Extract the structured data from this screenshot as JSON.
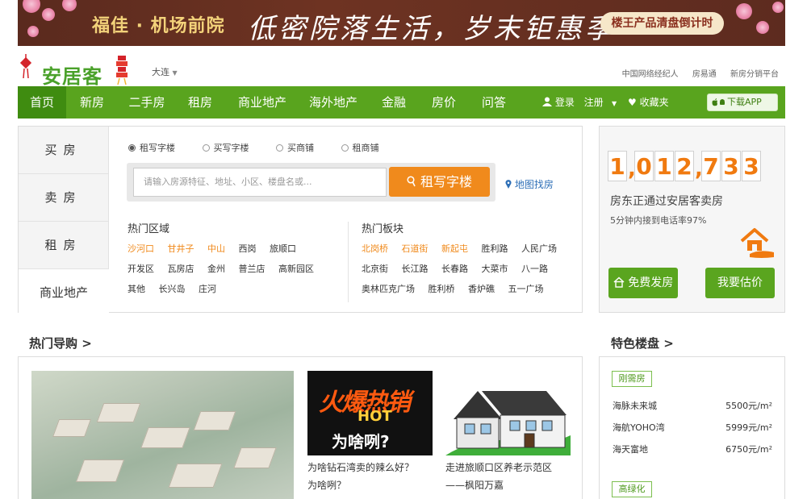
{
  "banner": {
    "brand": "福佳 · 机场前院",
    "slogan": "低密院落生活，岁末钜惠季",
    "cta": "楼王产品清盘倒计时"
  },
  "header": {
    "logo_text": "安居客",
    "city": "大连",
    "links": [
      "中国网络经纪人",
      "房易通",
      "新房分销平台"
    ]
  },
  "nav": {
    "items": [
      "首页",
      "新房",
      "二手房",
      "租房",
      "商业地产",
      "海外地产",
      "金融",
      "房价",
      "问答"
    ],
    "login": "登录",
    "register": "注册",
    "favorites": "收藏夹",
    "app": "下载APP"
  },
  "search": {
    "side_tabs": [
      "买房",
      "卖房",
      "租房",
      "商业地产"
    ],
    "radios": [
      "租写字楼",
      "买写字楼",
      "买商铺",
      "租商铺"
    ],
    "placeholder": "请输入房源特征、地址、小区、楼盘名或...",
    "button": "租写字楼",
    "map_link": "地图找房",
    "hot_areas": {
      "title": "热门区域",
      "rows": [
        [
          "沙河口",
          "甘井子",
          "中山",
          "西岗",
          "旅顺口"
        ],
        [
          "开发区",
          "瓦房店",
          "金州",
          "普兰店",
          "高新园区"
        ],
        [
          "其他",
          "长兴岛",
          "庄河"
        ]
      ]
    },
    "hot_blocks": {
      "title": "热门板块",
      "rows": [
        [
          "北岗桥",
          "石道街",
          "新起屯",
          "胜利路",
          "人民广场"
        ],
        [
          "北京街",
          "长江路",
          "长春路",
          "大菜市",
          "八一路"
        ],
        [
          "奥林匹克广场",
          "胜利桥",
          "香炉礁",
          "五一广场"
        ]
      ]
    }
  },
  "counter": {
    "digits": [
      "1",
      ",",
      "0",
      "1",
      "2",
      ",",
      "7",
      "3",
      "3"
    ],
    "title": "房东正通过安居客卖房",
    "subtitle": "5分钟内接到电话率97%",
    "btn_publish": "免费发房",
    "btn_estimate": "我要估价"
  },
  "guide": {
    "title": "热门导购 >",
    "img2_text": "火爆热销",
    "img2_hot": "HOT",
    "img2_question": "为啥咧?",
    "article1": [
      "为啥钻石湾卖的辣么好？",
      "为啥咧？"
    ],
    "article2": [
      "走进旅顺口区养老示范区",
      "——枫阳万嘉"
    ]
  },
  "featured": {
    "title": "特色楼盘 >",
    "tags": [
      "刚需房",
      "高绿化"
    ],
    "rows": [
      {
        "name": "海脉未来城",
        "price": "5500元/m²"
      },
      {
        "name": "海航YOHO湾",
        "price": "5999元/m²"
      },
      {
        "name": "海天富地",
        "price": "6750元/m²"
      }
    ]
  }
}
